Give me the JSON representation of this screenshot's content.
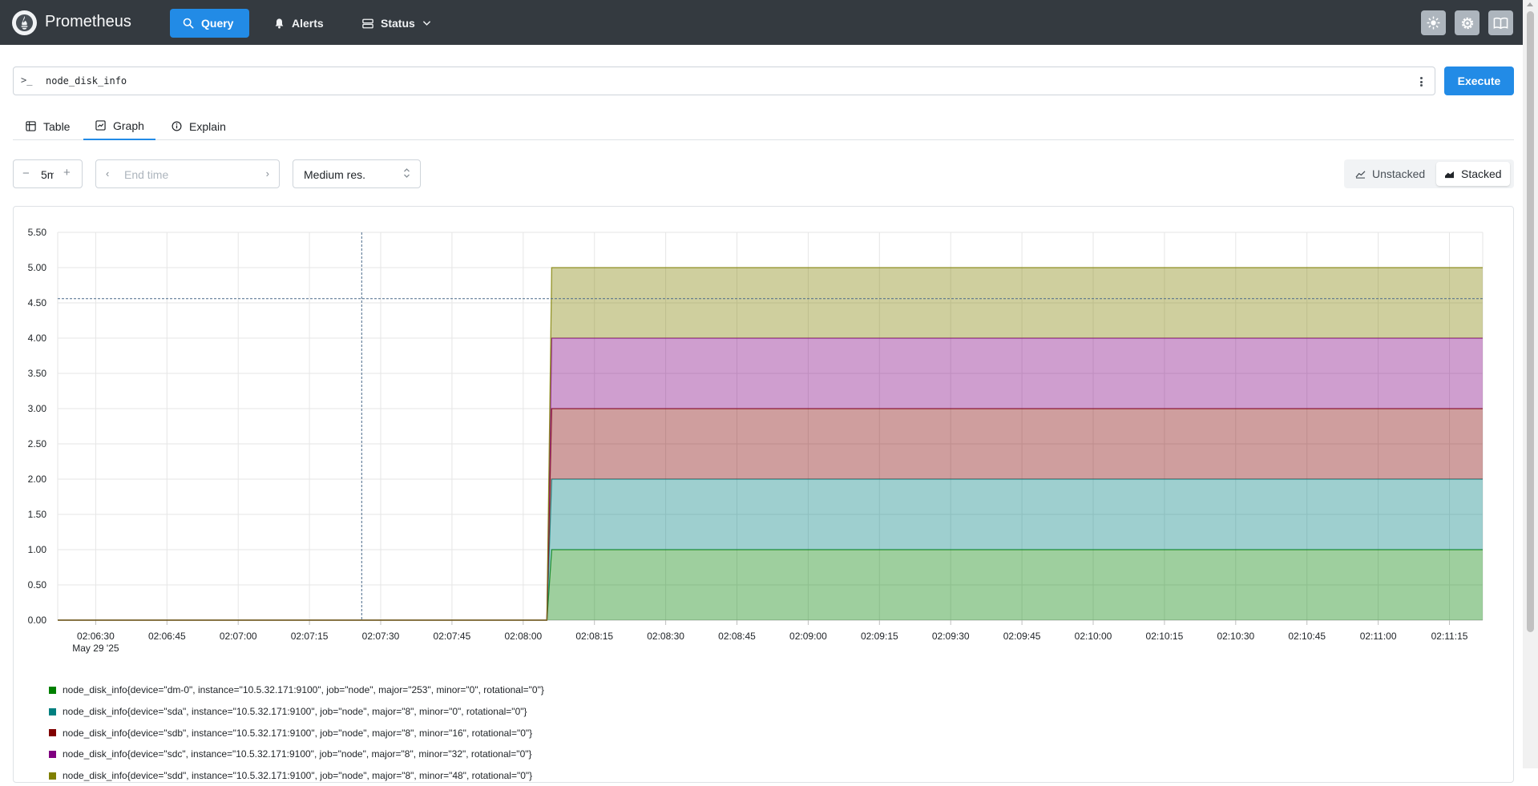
{
  "header": {
    "brand": "Prometheus",
    "nav": [
      {
        "label": "Query",
        "icon": "search-icon"
      },
      {
        "label": "Alerts",
        "icon": "bell-icon"
      },
      {
        "label": "Status",
        "icon": "server-icon"
      }
    ],
    "icons": [
      "sun-icon",
      "gear-icon",
      "book-icon"
    ]
  },
  "query": {
    "prompt": ">_",
    "expression": "node_disk_info",
    "execute_label": "Execute"
  },
  "tabs": [
    {
      "label": "Table",
      "icon": "table-icon"
    },
    {
      "label": "Graph",
      "icon": "graph-icon",
      "active": true
    },
    {
      "label": "Explain",
      "icon": "info-icon"
    }
  ],
  "controls": {
    "range": "5m",
    "end_time_placeholder": "End time",
    "resolution": "Medium res.",
    "unstacked_label": "Unstacked",
    "stacked_label": "Stacked",
    "mode": "stacked"
  },
  "chart_data": {
    "type": "area",
    "stacked": true,
    "ylim": [
      0,
      5.5
    ],
    "y_ticks": [
      "0.00",
      "0.50",
      "1.00",
      "1.50",
      "2.00",
      "2.50",
      "3.00",
      "3.50",
      "4.00",
      "4.50",
      "5.00",
      "5.50"
    ],
    "x_ticks": [
      "02:06:30",
      "02:06:45",
      "02:07:00",
      "02:07:15",
      "02:07:30",
      "02:07:45",
      "02:08:00",
      "02:08:15",
      "02:08:30",
      "02:08:45",
      "02:09:00",
      "02:09:15",
      "02:09:30",
      "02:09:45",
      "02:10:00",
      "02:10:15",
      "02:10:30",
      "02:10:45",
      "02:11:00",
      "02:11:15"
    ],
    "x_date_label": "May 29 '25",
    "x_range": [
      "02:06:22",
      "02:11:22"
    ],
    "grid": true,
    "step_start": "02:08:06",
    "hover_time": "02:07:26",
    "hover_value": 4.56,
    "series": [
      {
        "name": "node_disk_info{device=\"dm-0\", instance=\"10.5.32.171:9100\", job=\"node\", major=\"253\", minor=\"0\", rotational=\"0\"}",
        "color": "#008000",
        "value": 1
      },
      {
        "name": "node_disk_info{device=\"sda\", instance=\"10.5.32.171:9100\", job=\"node\", major=\"8\", minor=\"0\", rotational=\"0\"}",
        "color": "#008080",
        "value": 1
      },
      {
        "name": "node_disk_info{device=\"sdb\", instance=\"10.5.32.171:9100\", job=\"node\", major=\"8\", minor=\"16\", rotational=\"0\"}",
        "color": "#800000",
        "value": 1
      },
      {
        "name": "node_disk_info{device=\"sdc\", instance=\"10.5.32.171:9100\", job=\"node\", major=\"8\", minor=\"32\", rotational=\"0\"}",
        "color": "#800080",
        "value": 1
      },
      {
        "name": "node_disk_info{device=\"sdd\", instance=\"10.5.32.171:9100\", job=\"node\", major=\"8\", minor=\"48\", rotational=\"0\"}",
        "color": "#808000",
        "value": 1
      }
    ]
  }
}
